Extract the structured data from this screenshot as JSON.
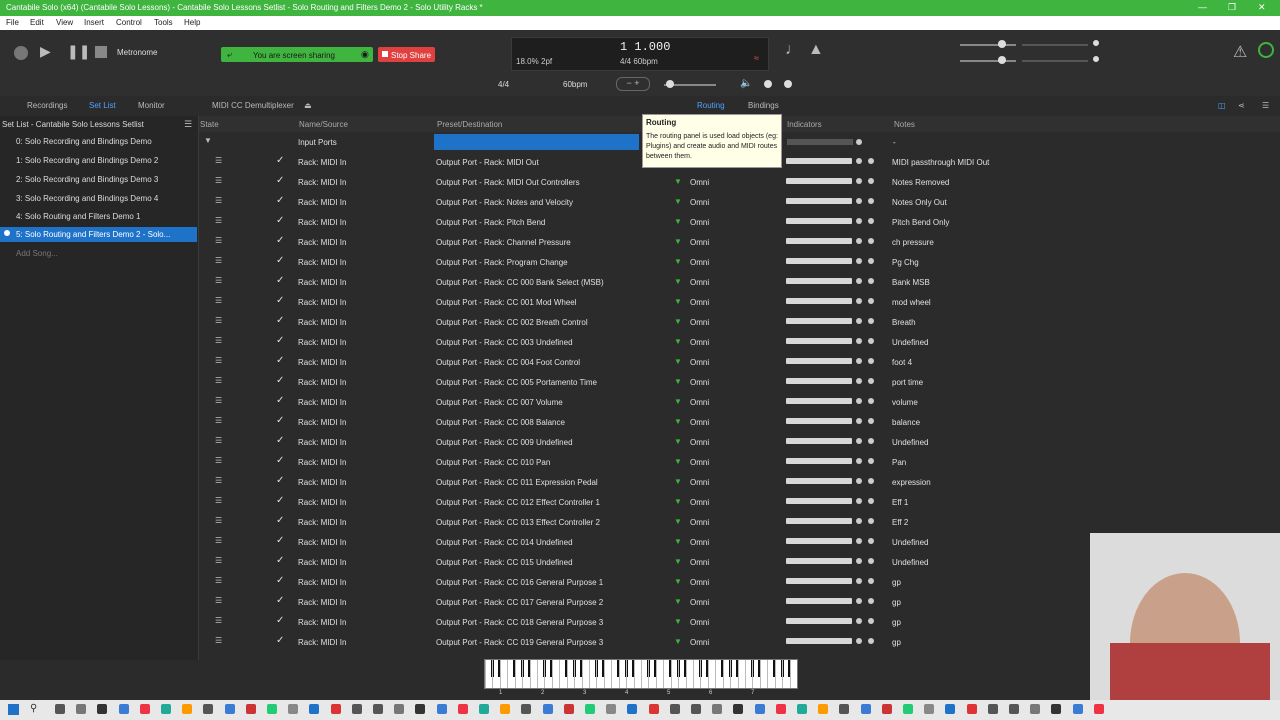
{
  "window": {
    "title": "Cantabile Solo (x64) (Cantabile Solo Lessons) - Cantabile Solo Lessons Setlist - Solo Routing and Filters Demo 2 - Solo Utility Racks *"
  },
  "menu": [
    "File",
    "Edit",
    "View",
    "Insert",
    "Control",
    "Tools",
    "Help"
  ],
  "transport": {
    "metronome_label": "Metronome",
    "screen_sharing": "You are screen sharing",
    "stop_share": "Stop Share",
    "position": "1 1.000",
    "load": "18.0%",
    "pf": "2pf",
    "signature_tempo": "4/4 60bpm",
    "time_signature": "4/4",
    "tempo": "60bpm"
  },
  "tabs": {
    "recordings": "Recordings",
    "setlist": "Set List",
    "monitor": "Monitor",
    "midi_cc": "MIDI CC Demultiplexer",
    "routing": "Routing",
    "bindings": "Bindings"
  },
  "sidebar": {
    "header": "Set List - Cantabile Solo Lessons Setlist",
    "items": [
      "0: Solo Recording and Bindings Demo",
      "1: Solo Recording and Bindings Demo 2",
      "2: Solo Recording and Bindings Demo 3",
      "3: Solo Recording and Bindings Demo 4",
      "4: Solo Routing and Filters Demo 1",
      "5: Solo Routing and Filters Demo 2 - Solo..."
    ],
    "add_song": "Add Song..."
  },
  "columns": {
    "state": "State",
    "name": "Name/Source",
    "preset": "Preset/Destination",
    "indicators": "Indicators",
    "notes": "Notes"
  },
  "group": {
    "label": "Input Ports",
    "notes": "-"
  },
  "tooltip": {
    "title": "Routing",
    "body": "The routing panel is used load objects (eg: Plugins) and create audio and MIDI routes between them."
  },
  "rows": [
    {
      "source": "Rack: MIDI In",
      "dest": "Output Port - Rack: MIDI Out",
      "channel": "",
      "note": "MIDI passthrough MIDI Out"
    },
    {
      "source": "Rack: MIDI In",
      "dest": "Output Port - Rack: MIDI Out Controllers",
      "channel": "Omni",
      "note": "Notes Removed"
    },
    {
      "source": "Rack: MIDI In",
      "dest": "Output Port - Rack: Notes and Velocity",
      "channel": "Omni",
      "note": "Notes Only Out"
    },
    {
      "source": "Rack: MIDI In",
      "dest": "Output Port - Rack: Pitch Bend",
      "channel": "Omni",
      "note": "Pitch Bend Only"
    },
    {
      "source": "Rack: MIDI In",
      "dest": "Output Port - Rack: Channel Pressure",
      "channel": "Omni",
      "note": "ch pressure"
    },
    {
      "source": "Rack: MIDI In",
      "dest": "Output Port - Rack: Program Change",
      "channel": "Omni",
      "note": "Pg Chg"
    },
    {
      "source": "Rack: MIDI In",
      "dest": "Output Port - Rack: CC 000 Bank Select (MSB)",
      "channel": "Omni",
      "note": "Bank MSB"
    },
    {
      "source": "Rack: MIDI In",
      "dest": "Output Port - Rack: CC 001 Mod Wheel",
      "channel": "Omni",
      "note": "mod wheel"
    },
    {
      "source": "Rack: MIDI In",
      "dest": "Output Port - Rack: CC 002 Breath Control",
      "channel": "Omni",
      "note": "Breath"
    },
    {
      "source": "Rack: MIDI In",
      "dest": "Output Port - Rack: CC 003 Undefined",
      "channel": "Omni",
      "note": "Undefined"
    },
    {
      "source": "Rack: MIDI In",
      "dest": "Output Port - Rack: CC 004 Foot Control",
      "channel": "Omni",
      "note": "foot 4"
    },
    {
      "source": "Rack: MIDI In",
      "dest": "Output Port - Rack: CC 005 Portamento Time",
      "channel": "Omni",
      "note": "port time"
    },
    {
      "source": "Rack: MIDI In",
      "dest": "Output Port - Rack: CC 007 Volume",
      "channel": "Omni",
      "note": "volume"
    },
    {
      "source": "Rack: MIDI In",
      "dest": "Output Port - Rack: CC 008 Balance",
      "channel": "Omni",
      "note": "balance"
    },
    {
      "source": "Rack: MIDI In",
      "dest": "Output Port - Rack: CC 009 Undefined",
      "channel": "Omni",
      "note": "Undefined"
    },
    {
      "source": "Rack: MIDI In",
      "dest": "Output Port - Rack: CC 010 Pan",
      "channel": "Omni",
      "note": "Pan"
    },
    {
      "source": "Rack: MIDI In",
      "dest": "Output Port - Rack: CC 011 Expression Pedal",
      "channel": "Omni",
      "note": "expression"
    },
    {
      "source": "Rack: MIDI In",
      "dest": "Output Port - Rack: CC 012 Effect Controller 1",
      "channel": "Omni",
      "note": "Eff 1"
    },
    {
      "source": "Rack: MIDI In",
      "dest": "Output Port - Rack: CC 013 Effect Controller 2",
      "channel": "Omni",
      "note": "Eff 2"
    },
    {
      "source": "Rack: MIDI In",
      "dest": "Output Port - Rack: CC 014 Undefined",
      "channel": "Omni",
      "note": "Undefined"
    },
    {
      "source": "Rack: MIDI In",
      "dest": "Output Port - Rack: CC 015 Undefined",
      "channel": "Omni",
      "note": "Undefined"
    },
    {
      "source": "Rack: MIDI In",
      "dest": "Output Port - Rack: CC 016 General Purpose 1",
      "channel": "Omni",
      "note": "gp"
    },
    {
      "source": "Rack: MIDI In",
      "dest": "Output Port - Rack: CC 017 General Purpose 2",
      "channel": "Omni",
      "note": "gp"
    },
    {
      "source": "Rack: MIDI In",
      "dest": "Output Port - Rack: CC 018 General Purpose 3",
      "channel": "Omni",
      "note": "gp"
    },
    {
      "source": "Rack: MIDI In",
      "dest": "Output Port - Rack: CC 019 General Purpose 3",
      "channel": "Omni",
      "note": "gp"
    }
  ],
  "piano_labels": [
    "1",
    "2",
    "3",
    "4",
    "5",
    "6",
    "7"
  ],
  "colors": {
    "accent_green": "#3fb43f",
    "stop_red": "#e04040",
    "selection_blue": "#1e73c8",
    "background": "#2b2b2b"
  }
}
